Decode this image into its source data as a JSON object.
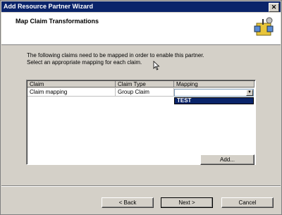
{
  "window": {
    "title": "Add Resource Partner Wizard"
  },
  "header": {
    "heading": "Map Claim Transformations"
  },
  "description": {
    "line1": "The following claims need to be mapped in order to enable this partner.",
    "line2": "Select an appropriate mapping for each claim."
  },
  "grid": {
    "columns": [
      "Claim",
      "Claim Type",
      "Mapping"
    ],
    "rows": [
      {
        "claim": "Claim mapping",
        "claim_type": "Group Claim",
        "mapping": ""
      }
    ],
    "dropdown_options": [
      "TEST"
    ]
  },
  "buttons": {
    "add": "Add...",
    "back": "< Back",
    "next": "Next >",
    "cancel": "Cancel"
  },
  "colors": {
    "titlebar": "#0a246a",
    "selection": "#0a246a",
    "face": "#d4d0c8"
  }
}
